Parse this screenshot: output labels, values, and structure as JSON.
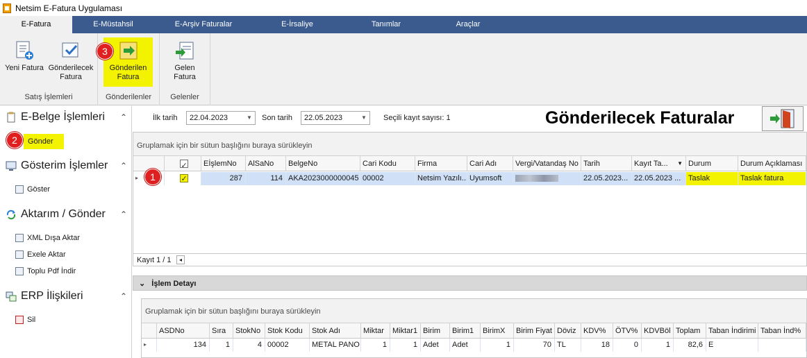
{
  "window": {
    "title": "Netsim E-Fatura Uygulaması"
  },
  "ribbon": {
    "tabs": [
      "E-Fatura",
      "E-Müstahsil",
      "E-Arşiv Faturalar",
      "E-İrsaliye",
      "Tanımlar",
      "Araçlar"
    ],
    "groups": {
      "satis": {
        "label": "Satış İşlemleri",
        "new_invoice": "Yeni Fatura",
        "to_send_1": "Gönderilecek",
        "to_send_2": "Fatura"
      },
      "sent": {
        "label": "Gönderilenler",
        "btn_1": "Gönderilen",
        "btn_2": "Fatura"
      },
      "incoming": {
        "label": "Gelenler",
        "btn_1": "Gelen",
        "btn_2": "Fatura"
      }
    }
  },
  "badges": [
    "1",
    "2",
    "3"
  ],
  "leftnav": {
    "ebelge": {
      "title": "E-Belge İşlemleri",
      "send": "Gönder"
    },
    "gosterim": {
      "title": "Gösterim İşlemler",
      "show": "Göster"
    },
    "aktarim": {
      "title": "Aktarım / Gönder",
      "xml": "XML Dışa Aktar",
      "excel": "Exele Aktar",
      "pdf": "Toplu Pdf İndir"
    },
    "erp": {
      "title": "ERP İlişkileri",
      "delete": "Sil"
    }
  },
  "filters": {
    "start_label": "İlk tarih",
    "start_value": "22.04.2023",
    "end_label": "Son tarih",
    "end_value": "22.05.2023",
    "selected_count": "Seçili kayıt sayısı: 1"
  },
  "page_title": "Gönderilecek Faturalar",
  "grid": {
    "group_hint": "Gruplamak için bir sütun başlığını buraya sürükleyin",
    "columns": [
      "EİşlemNo",
      "AlSaNo",
      "BelgeNo",
      "Cari Kodu",
      "Firma",
      "Cari Adı",
      "Vergi/Vatandaş No",
      "Tarih",
      "Kayıt Ta...",
      "Durum",
      "Durum Açıklaması"
    ],
    "row": {
      "eislemno": "287",
      "alsano": "114",
      "belgeno": "AKA2023000000045",
      "cari_kodu": "00002",
      "firma": "Netsim Yazılı...",
      "cari_adi": "Uyumsoft",
      "tarih": "22.05.2023...",
      "kayit_tarihi": "22.05.2023 ...",
      "durum": "Taslak",
      "durum_aciklamasi": "Taslak fatura"
    },
    "footer": "Kayıt 1 / 1"
  },
  "detail": {
    "title": "İşlem Detayı",
    "group_hint": "Gruplamak için bir sütun başlığını buraya sürükleyin",
    "columns": [
      "ASDNo",
      "Sıra",
      "StokNo",
      "Stok Kodu",
      "Stok Adı",
      "Miktar",
      "Miktar1",
      "Birim",
      "Birim1",
      "BirimX",
      "Birim Fiyat",
      "Döviz",
      "KDV%",
      "ÖTV%",
      "KDVBöl",
      "Toplam",
      "Taban İndirimi",
      "Taban İnd%"
    ],
    "row": {
      "asdno": "134",
      "sira": "1",
      "stokno": "4",
      "stok_kodu": "00002",
      "stok_adi": "METAL PANO",
      "miktar": "1",
      "miktar1": "1",
      "birim": "Adet",
      "birim1": "Adet",
      "birimx": "1",
      "birim_fiyat": "70",
      "doviz": "TL",
      "kdv": "18",
      "otv": "0",
      "kdvbol": "1",
      "toplam": "82,6",
      "taban": "E"
    }
  },
  "colors": {
    "accent": "#3b5b8f",
    "highlight": "#f3f300",
    "badge": "#e02020",
    "selected_row": "#cfe0f7"
  }
}
